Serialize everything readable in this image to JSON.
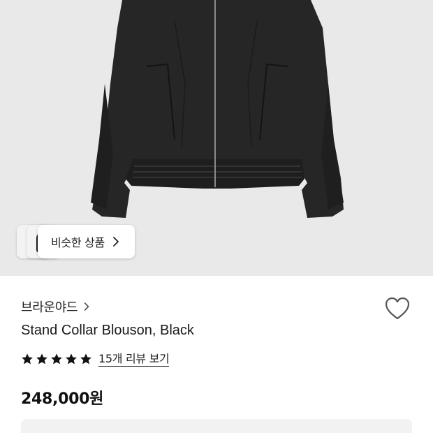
{
  "product_image": {
    "alt": "Black stand collar blouson",
    "icon": "jacket-photo"
  },
  "similar": {
    "label": "비슷한 상품",
    "icon": "chevron-right-icon"
  },
  "brand": {
    "name": "브라운야드",
    "icon": "chevron-right-icon"
  },
  "wishlist": {
    "icon": "heart-outline-icon"
  },
  "product": {
    "title": "Stand Collar Blouson, Black"
  },
  "rating": {
    "stars": 5,
    "max_stars": 5,
    "review_link": "15개 리뷰 보기"
  },
  "price": {
    "display": "248,000원"
  },
  "colors": {
    "hero_bg": "#e9e9ea",
    "jacket": "#232323",
    "text": "#111111",
    "box_bg": "#f2f2f3"
  }
}
